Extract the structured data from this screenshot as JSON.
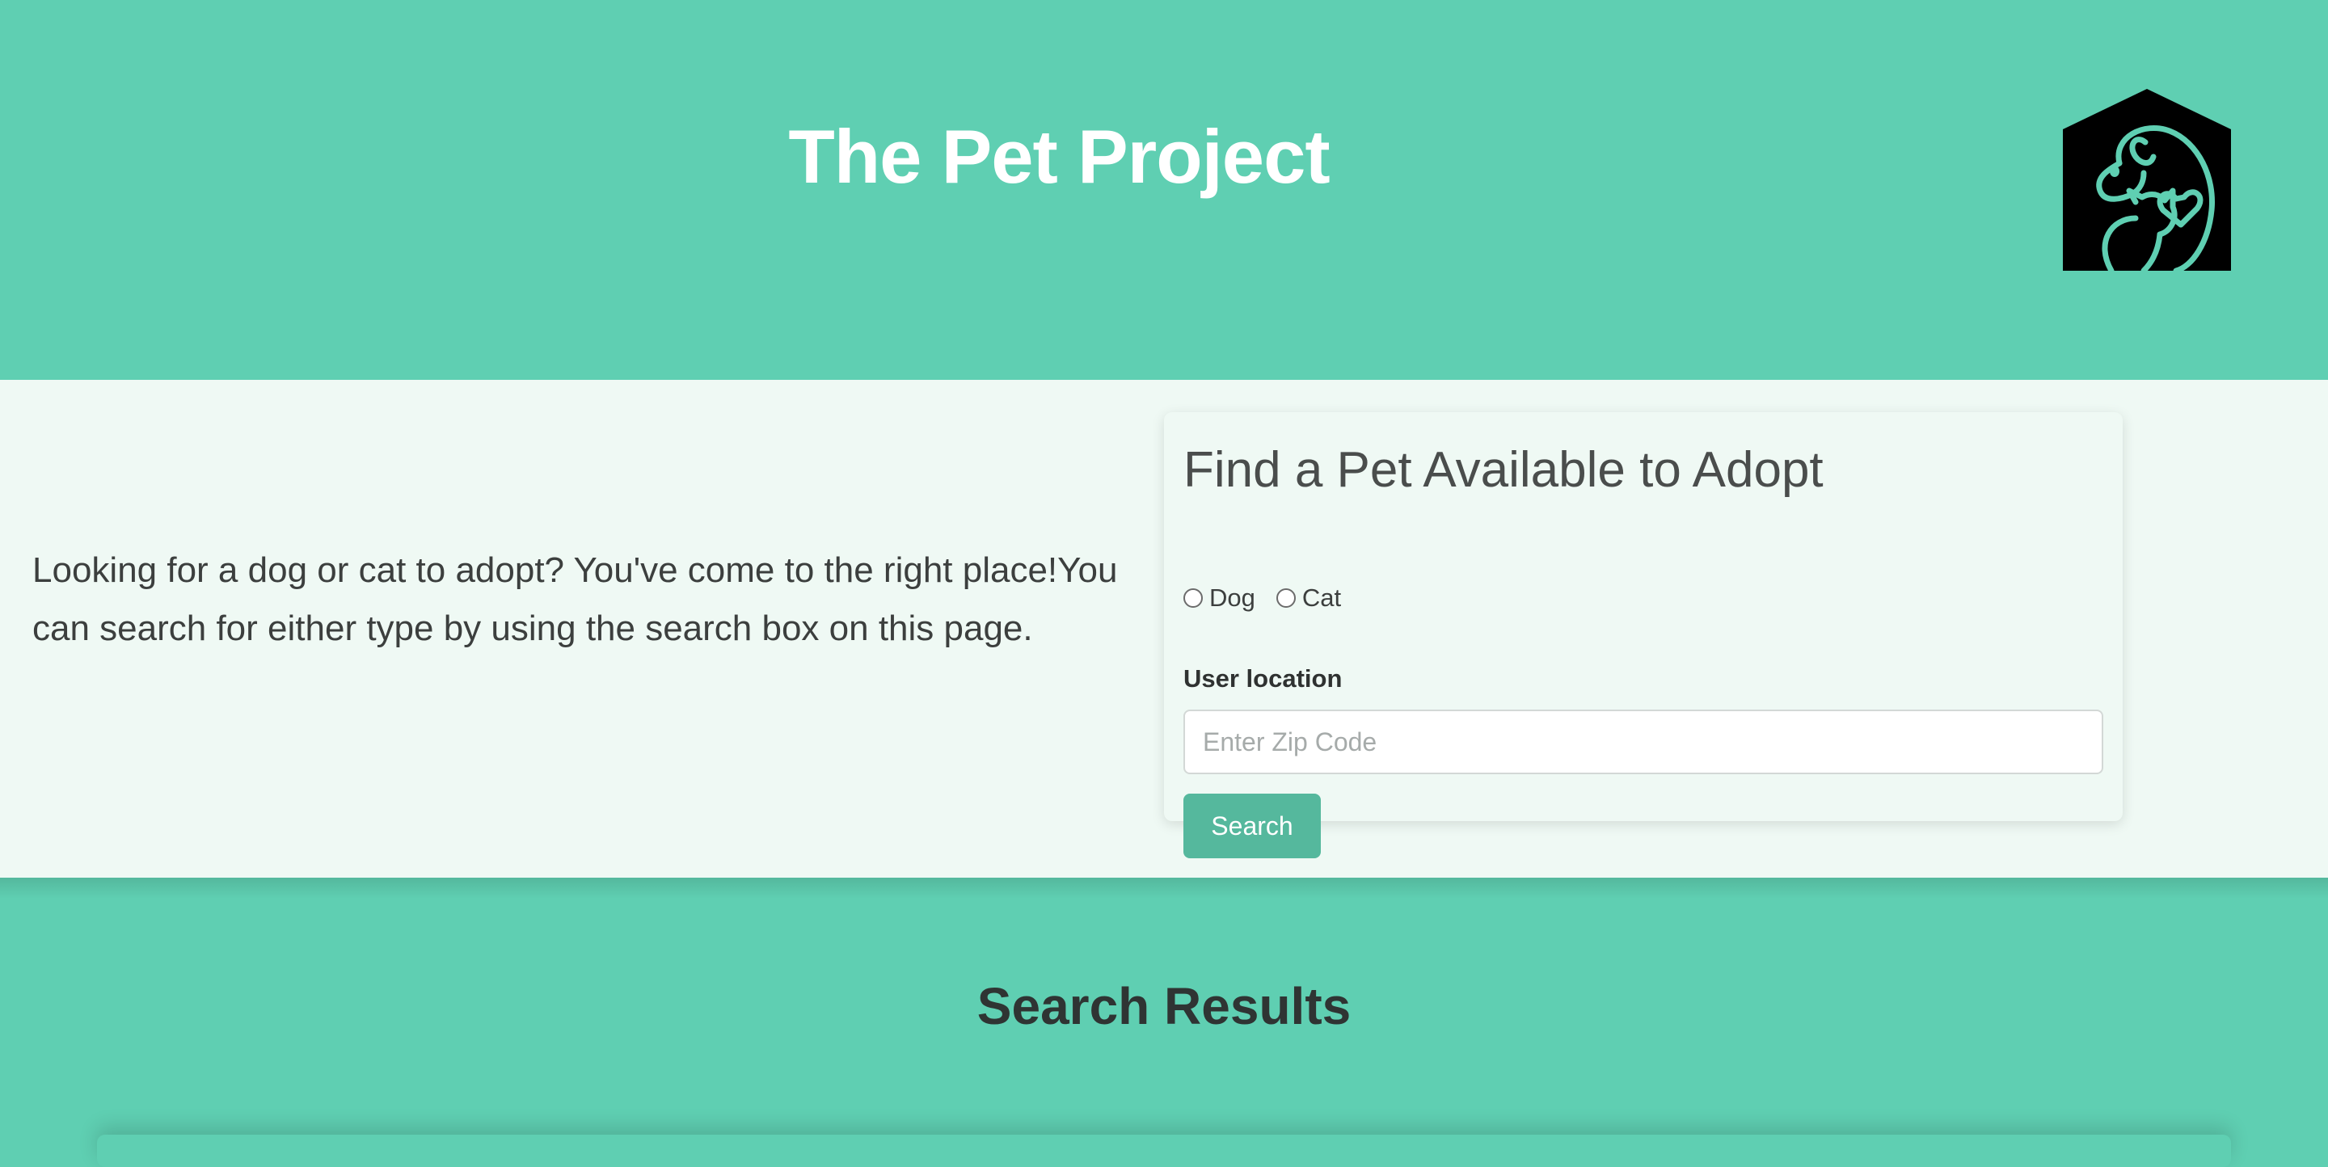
{
  "header": {
    "title": "The Pet Project",
    "logo_icon": "pet-house-logo-icon"
  },
  "intro": {
    "text": "Looking for a dog or cat to adopt? You've come to the right place!You can search for either type by using the search box on this page."
  },
  "search_card": {
    "title": "Find a Pet Available to Adopt",
    "radio_options": [
      "Dog",
      "Cat"
    ],
    "location_label": "User location",
    "zip_placeholder": "Enter Zip Code",
    "zip_value": "",
    "search_button": "Search"
  },
  "results": {
    "title": "Search Results"
  },
  "colors": {
    "brand_green": "#5fcfb2",
    "light_bg": "#eff9f4",
    "button_green": "#55b89d"
  }
}
